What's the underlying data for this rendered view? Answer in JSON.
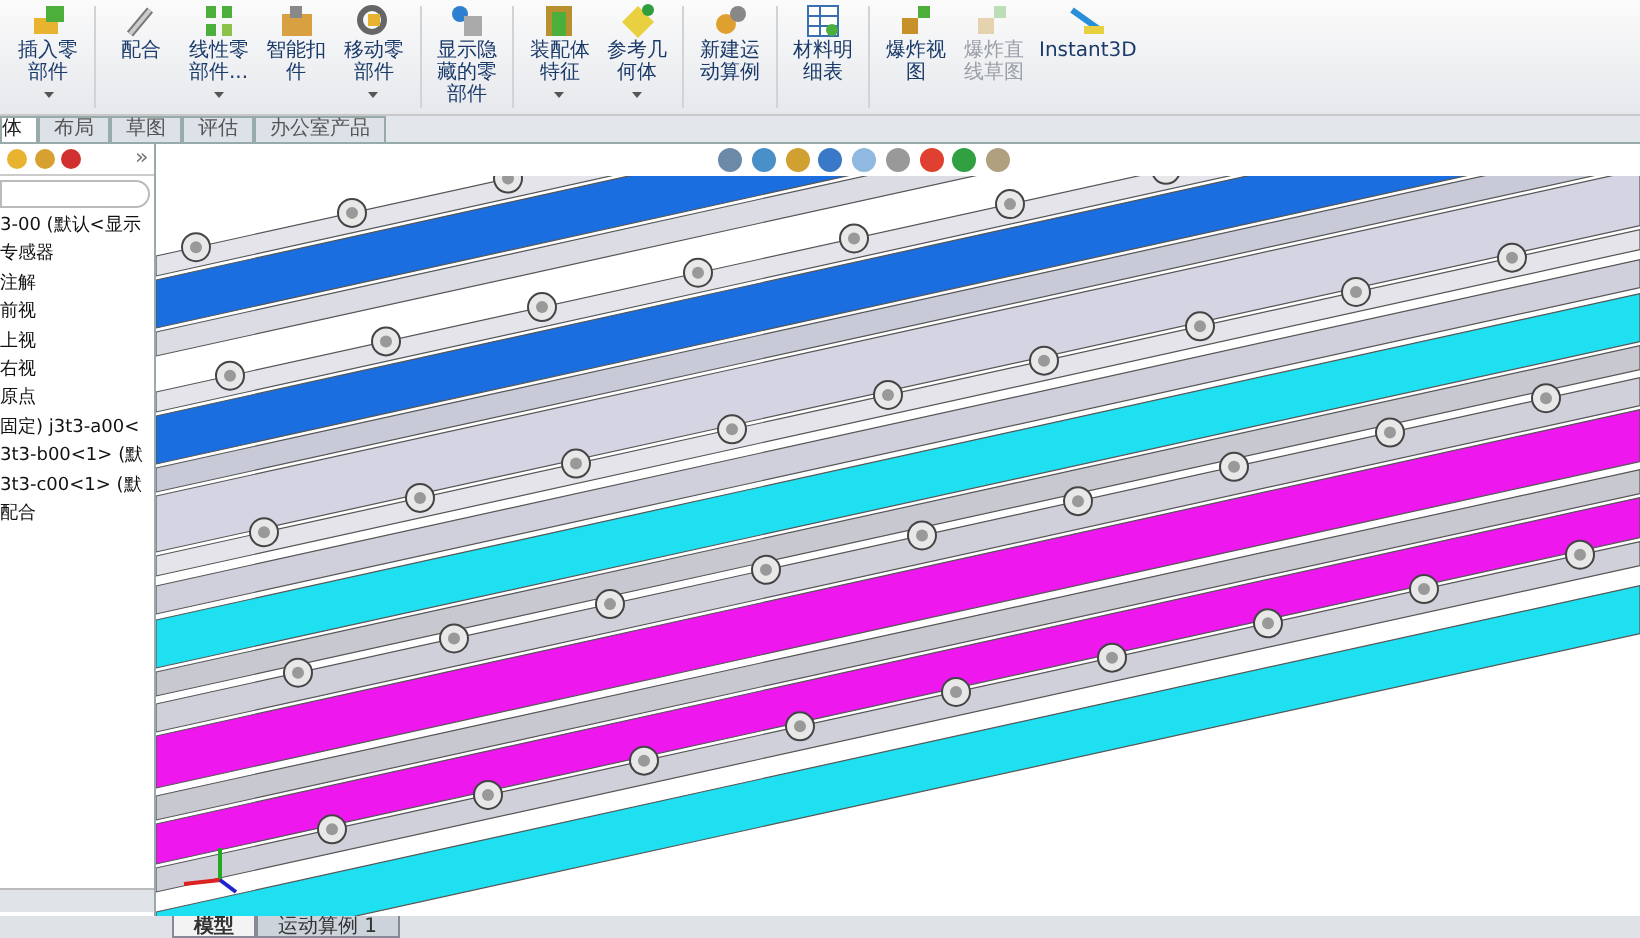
{
  "toolbar": [
    {
      "label": "插入零部件",
      "has_menu": true,
      "disabled": false
    },
    {
      "label": "配合",
      "has_menu": false,
      "disabled": false
    },
    {
      "label": "线性零部件...",
      "has_menu": true,
      "disabled": false
    },
    {
      "label": "智能扣件",
      "has_menu": false,
      "disabled": false
    },
    {
      "label": "移动零部件",
      "has_menu": true,
      "disabled": false
    },
    {
      "label": "显示隐藏的零部件",
      "has_menu": false,
      "disabled": false
    },
    {
      "label": "装配体特征",
      "has_menu": true,
      "disabled": false
    },
    {
      "label": "参考几何体",
      "has_menu": true,
      "disabled": false
    },
    {
      "label": "新建运动算例",
      "has_menu": false,
      "disabled": false
    },
    {
      "label": "材料明细表",
      "has_menu": false,
      "disabled": false
    },
    {
      "label": "爆炸视图",
      "has_menu": false,
      "disabled": false
    },
    {
      "label": "爆炸直线草图",
      "has_menu": false,
      "disabled": true
    },
    {
      "label": "Instant3D",
      "has_menu": false,
      "disabled": false
    }
  ],
  "tabs": [
    {
      "label": "体",
      "selected": true
    },
    {
      "label": "布局",
      "selected": false
    },
    {
      "label": "草图",
      "selected": false
    },
    {
      "label": "评估",
      "selected": false
    },
    {
      "label": "办公室产品",
      "selected": false
    }
  ],
  "panel_tabs_more": "»",
  "tree": [
    {
      "label": "3-00  (默认<显示"
    },
    {
      "label": "专感器"
    },
    {
      "label": "注解"
    },
    {
      "label": "前视"
    },
    {
      "label": "上视"
    },
    {
      "label": "右视"
    },
    {
      "label": "原点"
    },
    {
      "label": "固定) j3t3-a00<"
    },
    {
      "label": "3t3-b00<1> (默"
    },
    {
      "label": "3t3-c00<1> (默"
    },
    {
      "label": "配合"
    }
  ],
  "bottom_tabs": [
    {
      "label": "模型",
      "selected": true
    },
    {
      "label": "运动算例 1",
      "selected": false
    }
  ]
}
